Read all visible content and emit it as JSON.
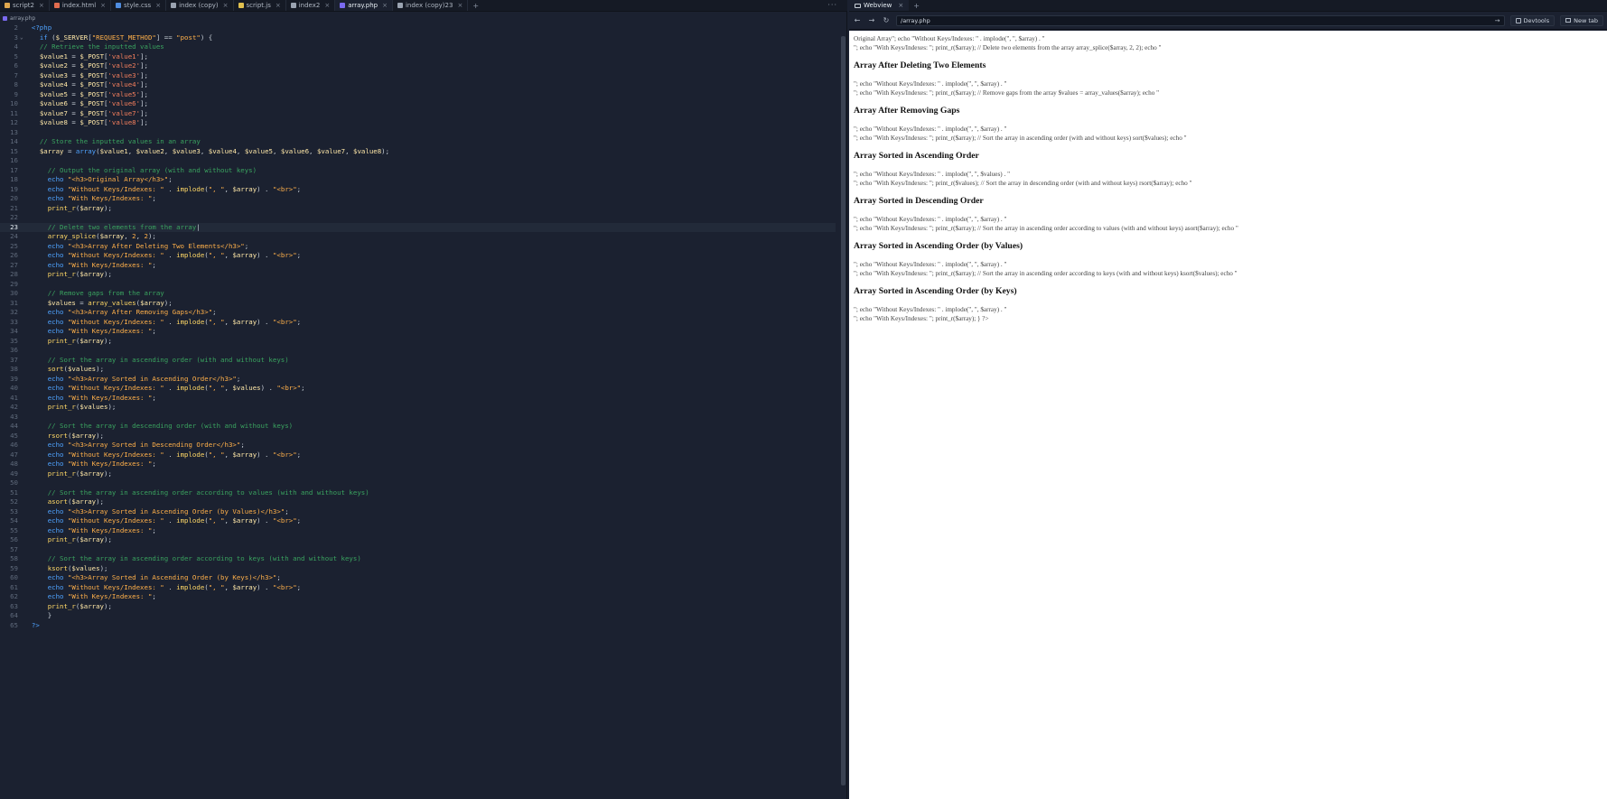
{
  "editor": {
    "tabs": [
      {
        "label": "script2",
        "color": "#e0a84f"
      },
      {
        "label": "index.html",
        "color": "#e06c4f"
      },
      {
        "label": "style.css",
        "color": "#4f8de0"
      },
      {
        "label": "index (copy)",
        "color": "#9aa3b1"
      },
      {
        "label": "script.js",
        "color": "#e0c04f"
      },
      {
        "label": "index2",
        "color": "#9aa3b1"
      },
      {
        "label": "array.php",
        "color": "#7a6af0"
      },
      {
        "label": "index (copy)23",
        "color": "#9aa3b1"
      }
    ],
    "tab_close": "×",
    "tab_add": "+",
    "menu": "···",
    "breadcrumb": "array.php",
    "lines": [
      {
        "n": "2",
        "fold": "",
        "html": "  <span class='php'>&lt;?php</span>"
      },
      {
        "n": "3",
        "fold": "⌄",
        "html": "    <span class='kw'>if</span> (<span class='var'>$_SERVER</span>[<span class='str'>\"REQUEST_METHOD\"</span>] == <span class='str'>\"post\"</span>) {"
      },
      {
        "n": "4",
        "fold": "",
        "html": "    <span class='cmt'>// Retrieve the inputted values</span>"
      },
      {
        "n": "5",
        "fold": "",
        "html": "    <span class='var'>$value1</span> = <span class='var'>$_POST</span>[<span class='str2'>'value1'</span>];"
      },
      {
        "n": "6",
        "fold": "",
        "html": "    <span class='var'>$value2</span> = <span class='var'>$_POST</span>[<span class='str2'>'value2'</span>];"
      },
      {
        "n": "7",
        "fold": "",
        "html": "    <span class='var'>$value3</span> = <span class='var'>$_POST</span>[<span class='str2'>'value3'</span>];"
      },
      {
        "n": "8",
        "fold": "",
        "html": "    <span class='var'>$value4</span> = <span class='var'>$_POST</span>[<span class='str2'>'value4'</span>];"
      },
      {
        "n": "9",
        "fold": "",
        "html": "    <span class='var'>$value5</span> = <span class='var'>$_POST</span>[<span class='str2'>'value5'</span>];"
      },
      {
        "n": "10",
        "fold": "",
        "html": "    <span class='var'>$value6</span> = <span class='var'>$_POST</span>[<span class='str2'>'value6'</span>];"
      },
      {
        "n": "11",
        "fold": "",
        "html": "    <span class='var'>$value7</span> = <span class='var'>$_POST</span>[<span class='str2'>'value7'</span>];"
      },
      {
        "n": "12",
        "fold": "",
        "html": "    <span class='var'>$value8</span> = <span class='var'>$_POST</span>[<span class='str2'>'value8'</span>];"
      },
      {
        "n": "13",
        "fold": "",
        "html": ""
      },
      {
        "n": "14",
        "fold": "",
        "html": "    <span class='cmt'>// Store the inputted values in an array</span>"
      },
      {
        "n": "15",
        "fold": "",
        "html": "    <span class='var'>$array</span> = <span class='kw'>array</span>(<span class='var'>$value1</span>, <span class='var'>$value2</span>, <span class='var'>$value3</span>, <span class='var'>$value4</span>, <span class='var'>$value5</span>, <span class='var'>$value6</span>, <span class='var'>$value7</span>, <span class='var'>$value8</span>);"
      },
      {
        "n": "16",
        "fold": "",
        "html": ""
      },
      {
        "n": "17",
        "fold": "",
        "html": "      <span class='cmt'>// Output the original array (with and without keys)</span>"
      },
      {
        "n": "18",
        "fold": "",
        "html": "      <span class='kw'>echo</span> <span class='str'>\"&lt;h3&gt;Original Array&lt;/h3&gt;\"</span>;"
      },
      {
        "n": "19",
        "fold": "",
        "html": "      <span class='kw'>echo</span> <span class='str'>\"Without Keys/Indexes: \"</span> . <span class='fn'>implode</span>(<span class='str'>\", \"</span>, <span class='var'>$array</span>) . <span class='str'>\"&lt;br&gt;\"</span>;"
      },
      {
        "n": "20",
        "fold": "",
        "html": "      <span class='kw'>echo</span> <span class='str'>\"With Keys/Indexes: \"</span>;"
      },
      {
        "n": "21",
        "fold": "",
        "html": "      <span class='fn'>print_r</span>(<span class='var'>$array</span>);"
      },
      {
        "n": "22",
        "fold": "",
        "html": ""
      },
      {
        "n": "23",
        "fold": "",
        "html": "      <span class='cmt'>// Delete two elements from the array</span>|",
        "current": true
      },
      {
        "n": "24",
        "fold": "",
        "html": "      <span class='fn'>array_splice</span>(<span class='var'>$array</span>, <span class='str'>2</span>, <span class='str'>2</span>);"
      },
      {
        "n": "25",
        "fold": "",
        "html": "      <span class='kw'>echo</span> <span class='str'>\"&lt;h3&gt;Array After Deleting Two Elements&lt;/h3&gt;\"</span>;"
      },
      {
        "n": "26",
        "fold": "",
        "html": "      <span class='kw'>echo</span> <span class='str'>\"Without Keys/Indexes: \"</span> . <span class='fn'>implode</span>(<span class='str'>\", \"</span>, <span class='var'>$array</span>) . <span class='str'>\"&lt;br&gt;\"</span>;"
      },
      {
        "n": "27",
        "fold": "",
        "html": "      <span class='kw'>echo</span> <span class='str'>\"With Keys/Indexes: \"</span>;"
      },
      {
        "n": "28",
        "fold": "",
        "html": "      <span class='fn'>print_r</span>(<span class='var'>$array</span>);"
      },
      {
        "n": "29",
        "fold": "",
        "html": ""
      },
      {
        "n": "30",
        "fold": "",
        "html": "      <span class='cmt'>// Remove gaps from the array</span>"
      },
      {
        "n": "31",
        "fold": "",
        "html": "      <span class='var'>$values</span> = <span class='fn'>array_values</span>(<span class='var'>$array</span>);"
      },
      {
        "n": "32",
        "fold": "",
        "html": "      <span class='kw'>echo</span> <span class='str'>\"&lt;h3&gt;Array After Removing Gaps&lt;/h3&gt;\"</span>;"
      },
      {
        "n": "33",
        "fold": "",
        "html": "      <span class='kw'>echo</span> <span class='str'>\"Without Keys/Indexes: \"</span> . <span class='fn'>implode</span>(<span class='str'>\", \"</span>, <span class='var'>$array</span>) . <span class='str'>\"&lt;br&gt;\"</span>;"
      },
      {
        "n": "34",
        "fold": "",
        "html": "      <span class='kw'>echo</span> <span class='str'>\"With Keys/Indexes: \"</span>;"
      },
      {
        "n": "35",
        "fold": "",
        "html": "      <span class='fn'>print_r</span>(<span class='var'>$array</span>);"
      },
      {
        "n": "36",
        "fold": "",
        "html": ""
      },
      {
        "n": "37",
        "fold": "",
        "html": "      <span class='cmt'>// Sort the array in ascending order (with and without keys)</span>"
      },
      {
        "n": "38",
        "fold": "",
        "html": "      <span class='fn'>sort</span>(<span class='var'>$values</span>);"
      },
      {
        "n": "39",
        "fold": "",
        "html": "      <span class='kw'>echo</span> <span class='str'>\"&lt;h3&gt;Array Sorted in Ascending Order&lt;/h3&gt;\"</span>;"
      },
      {
        "n": "40",
        "fold": "",
        "html": "      <span class='kw'>echo</span> <span class='str'>\"Without Keys/Indexes: \"</span> . <span class='fn'>implode</span>(<span class='str'>\", \"</span>, <span class='var'>$values</span>) . <span class='str'>\"&lt;br&gt;\"</span>;"
      },
      {
        "n": "41",
        "fold": "",
        "html": "      <span class='kw'>echo</span> <span class='str'>\"With Keys/Indexes: \"</span>;"
      },
      {
        "n": "42",
        "fold": "",
        "html": "      <span class='fn'>print_r</span>(<span class='var'>$values</span>);"
      },
      {
        "n": "43",
        "fold": "",
        "html": ""
      },
      {
        "n": "44",
        "fold": "",
        "html": "      <span class='cmt'>// Sort the array in descending order (with and without keys)</span>"
      },
      {
        "n": "45",
        "fold": "",
        "html": "      <span class='fn'>rsort</span>(<span class='var'>$array</span>);"
      },
      {
        "n": "46",
        "fold": "",
        "html": "      <span class='kw'>echo</span> <span class='str'>\"&lt;h3&gt;Array Sorted in Descending Order&lt;/h3&gt;\"</span>;"
      },
      {
        "n": "47",
        "fold": "",
        "html": "      <span class='kw'>echo</span> <span class='str'>\"Without Keys/Indexes: \"</span> . <span class='fn'>implode</span>(<span class='str'>\", \"</span>, <span class='var'>$array</span>) . <span class='str'>\"&lt;br&gt;\"</span>;"
      },
      {
        "n": "48",
        "fold": "",
        "html": "      <span class='kw'>echo</span> <span class='str'>\"With Keys/Indexes: \"</span>;"
      },
      {
        "n": "49",
        "fold": "",
        "html": "      <span class='fn'>print_r</span>(<span class='var'>$array</span>);"
      },
      {
        "n": "50",
        "fold": "",
        "html": ""
      },
      {
        "n": "51",
        "fold": "",
        "html": "      <span class='cmt'>// Sort the array in ascending order according to values (with and without keys)</span>"
      },
      {
        "n": "52",
        "fold": "",
        "html": "      <span class='fn'>asort</span>(<span class='var'>$array</span>);"
      },
      {
        "n": "53",
        "fold": "",
        "html": "      <span class='kw'>echo</span> <span class='str'>\"&lt;h3&gt;Array Sorted in Ascending Order (by Values)&lt;/h3&gt;\"</span>;"
      },
      {
        "n": "54",
        "fold": "",
        "html": "      <span class='kw'>echo</span> <span class='str'>\"Without Keys/Indexes: \"</span> . <span class='fn'>implode</span>(<span class='str'>\", \"</span>, <span class='var'>$array</span>) . <span class='str'>\"&lt;br&gt;\"</span>;"
      },
      {
        "n": "55",
        "fold": "",
        "html": "      <span class='kw'>echo</span> <span class='str'>\"With Keys/Indexes: \"</span>;"
      },
      {
        "n": "56",
        "fold": "",
        "html": "      <span class='fn'>print_r</span>(<span class='var'>$array</span>);"
      },
      {
        "n": "57",
        "fold": "",
        "html": ""
      },
      {
        "n": "58",
        "fold": "",
        "html": "      <span class='cmt'>// Sort the array in ascending order according to keys (with and without keys)</span>"
      },
      {
        "n": "59",
        "fold": "",
        "html": "      <span class='fn'>ksort</span>(<span class='var'>$values</span>);"
      },
      {
        "n": "60",
        "fold": "",
        "html": "      <span class='kw'>echo</span> <span class='str'>\"&lt;h3&gt;Array Sorted in Ascending Order (by Keys)&lt;/h3&gt;\"</span>;"
      },
      {
        "n": "61",
        "fold": "",
        "html": "      <span class='kw'>echo</span> <span class='str'>\"Without Keys/Indexes: \"</span> . <span class='fn'>implode</span>(<span class='str'>\", \"</span>, <span class='var'>$array</span>) . <span class='str'>\"&lt;br&gt;\"</span>;"
      },
      {
        "n": "62",
        "fold": "",
        "html": "      <span class='kw'>echo</span> <span class='str'>\"With Keys/Indexes: \"</span>;"
      },
      {
        "n": "63",
        "fold": "",
        "html": "      <span class='fn'>print_r</span>(<span class='var'>$array</span>);"
      },
      {
        "n": "64",
        "fold": "",
        "html": "      }"
      },
      {
        "n": "65",
        "fold": "",
        "html": "  <span class='php'>?&gt;</span>"
      }
    ]
  },
  "webview": {
    "tab_label": "Webview",
    "tab_close": "×",
    "tab_add": "+",
    "back": "←",
    "forward": "→",
    "reload": "↻",
    "url": "/array.php",
    "url_go": "→",
    "devtools_label": "Devtools",
    "newtab_label": "New tab",
    "page_blocks": [
      {
        "type": "txt",
        "text": "Original Array\"; echo \"Without Keys/Indexes: \" . implode(\", \", $array) . \""
      },
      {
        "type": "txt",
        "text": "\"; echo \"With Keys/Indexes: \"; print_r($array); // Delete two elements from the array array_splice($array, 2, 2); echo \""
      },
      {
        "type": "h3",
        "text": "Array After Deleting Two Elements"
      },
      {
        "type": "txt",
        "text": "\"; echo \"Without Keys/Indexes: \" . implode(\", \", $array) . \""
      },
      {
        "type": "txt",
        "text": "\"; echo \"With Keys/Indexes: \"; print_r($array); // Remove gaps from the array $values = array_values($array); echo \""
      },
      {
        "type": "h3",
        "text": "Array After Removing Gaps"
      },
      {
        "type": "txt",
        "text": "\"; echo \"Without Keys/Indexes: \" . implode(\", \", $array) . \""
      },
      {
        "type": "txt",
        "text": "\"; echo \"With Keys/Indexes: \"; print_r($array); // Sort the array in ascending order (with and without keys) sort($values); echo \""
      },
      {
        "type": "h3",
        "text": "Array Sorted in Ascending Order"
      },
      {
        "type": "txt",
        "text": "\"; echo \"Without Keys/Indexes: \" . implode(\", \", $values) . \""
      },
      {
        "type": "txt",
        "text": "\"; echo \"With Keys/Indexes: \"; print_r($values); // Sort the array in descending order (with and without keys) rsort($array); echo \""
      },
      {
        "type": "h3",
        "text": "Array Sorted in Descending Order"
      },
      {
        "type": "txt",
        "text": "\"; echo \"Without Keys/Indexes: \" . implode(\", \", $array) . \""
      },
      {
        "type": "txt",
        "text": "\"; echo \"With Keys/Indexes: \"; print_r($array); // Sort the array in ascending order according to values (with and without keys) asort($array); echo \""
      },
      {
        "type": "h3",
        "text": "Array Sorted in Ascending Order (by Values)"
      },
      {
        "type": "txt",
        "text": "\"; echo \"Without Keys/Indexes: \" . implode(\", \", $array) . \""
      },
      {
        "type": "txt",
        "text": "\"; echo \"With Keys/Indexes: \"; print_r($array); // Sort the array in ascending order according to keys (with and without keys) ksort($values); echo \""
      },
      {
        "type": "h3",
        "text": "Array Sorted in Ascending Order (by Keys)"
      },
      {
        "type": "txt",
        "text": "\"; echo \"Without Keys/Indexes: \" . implode(\", \", $array) . \""
      },
      {
        "type": "txt",
        "text": "\"; echo \"With Keys/Indexes: \"; print_r($array); } ?>"
      }
    ]
  }
}
